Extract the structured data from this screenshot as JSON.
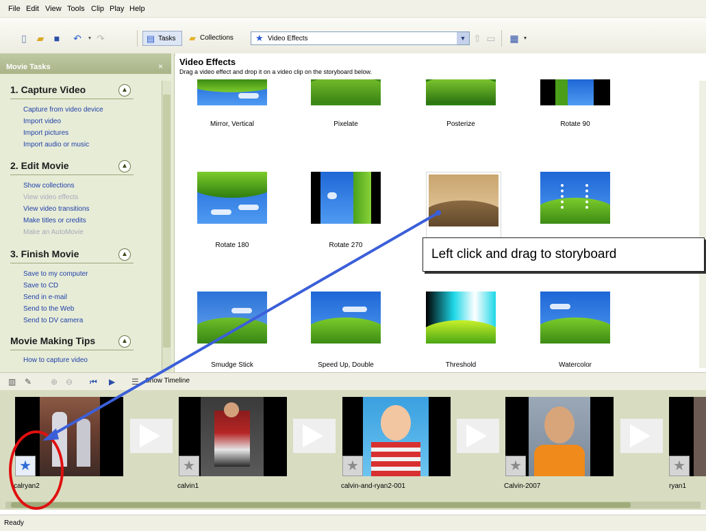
{
  "menu": [
    "File",
    "Edit",
    "View",
    "Tools",
    "Clip",
    "Play",
    "Help"
  ],
  "toolbar": {
    "tasks_label": "Tasks",
    "collections_label": "Collections",
    "effects_select_value": "Video Effects"
  },
  "taskpane": {
    "header": "Movie Tasks",
    "sections": [
      {
        "title": "1. Capture Video",
        "links": [
          {
            "label": "Capture from video device",
            "enabled": true
          },
          {
            "label": "Import video",
            "enabled": true
          },
          {
            "label": "Import pictures",
            "enabled": true
          },
          {
            "label": "Import audio or music",
            "enabled": true
          }
        ]
      },
      {
        "title": "2. Edit Movie",
        "links": [
          {
            "label": "Show collections",
            "enabled": true
          },
          {
            "label": "View video effects",
            "enabled": false
          },
          {
            "label": "View video transitions",
            "enabled": true
          },
          {
            "label": "Make titles or credits",
            "enabled": true
          },
          {
            "label": "Make an AutoMovie",
            "enabled": false
          }
        ]
      },
      {
        "title": "3. Finish Movie",
        "links": [
          {
            "label": "Save to my computer",
            "enabled": true
          },
          {
            "label": "Save to CD",
            "enabled": true
          },
          {
            "label": "Send in e-mail",
            "enabled": true
          },
          {
            "label": "Send to the Web",
            "enabled": true
          },
          {
            "label": "Send to DV camera",
            "enabled": true
          }
        ]
      },
      {
        "title": "Movie Making Tips",
        "links": [
          {
            "label": "How to capture video",
            "enabled": true
          }
        ]
      }
    ]
  },
  "effects": {
    "title": "Video Effects",
    "subtitle": "Drag a video effect and drop it on a video clip on the storyboard below.",
    "items": [
      "Mirror, Vertical",
      "Pixelate",
      "Posterize",
      "Rotate 90",
      "Rotate 180",
      "Rotate 270",
      "",
      "",
      "Smudge Stick",
      "Speed Up, Double",
      "Threshold",
      "Watercolor"
    ]
  },
  "callout": "Left click and drag to storyboard",
  "storyboard": {
    "show_timeline_label": "Show Timeline",
    "clips": [
      "calryan2",
      "calvin1",
      "calvin-and-ryan2-001",
      "Calvin-2007",
      "ryan1"
    ]
  },
  "status": "Ready",
  "colors": {
    "annotation_arrow": "#3b5fd9",
    "annotation_circle": "#e01010"
  }
}
